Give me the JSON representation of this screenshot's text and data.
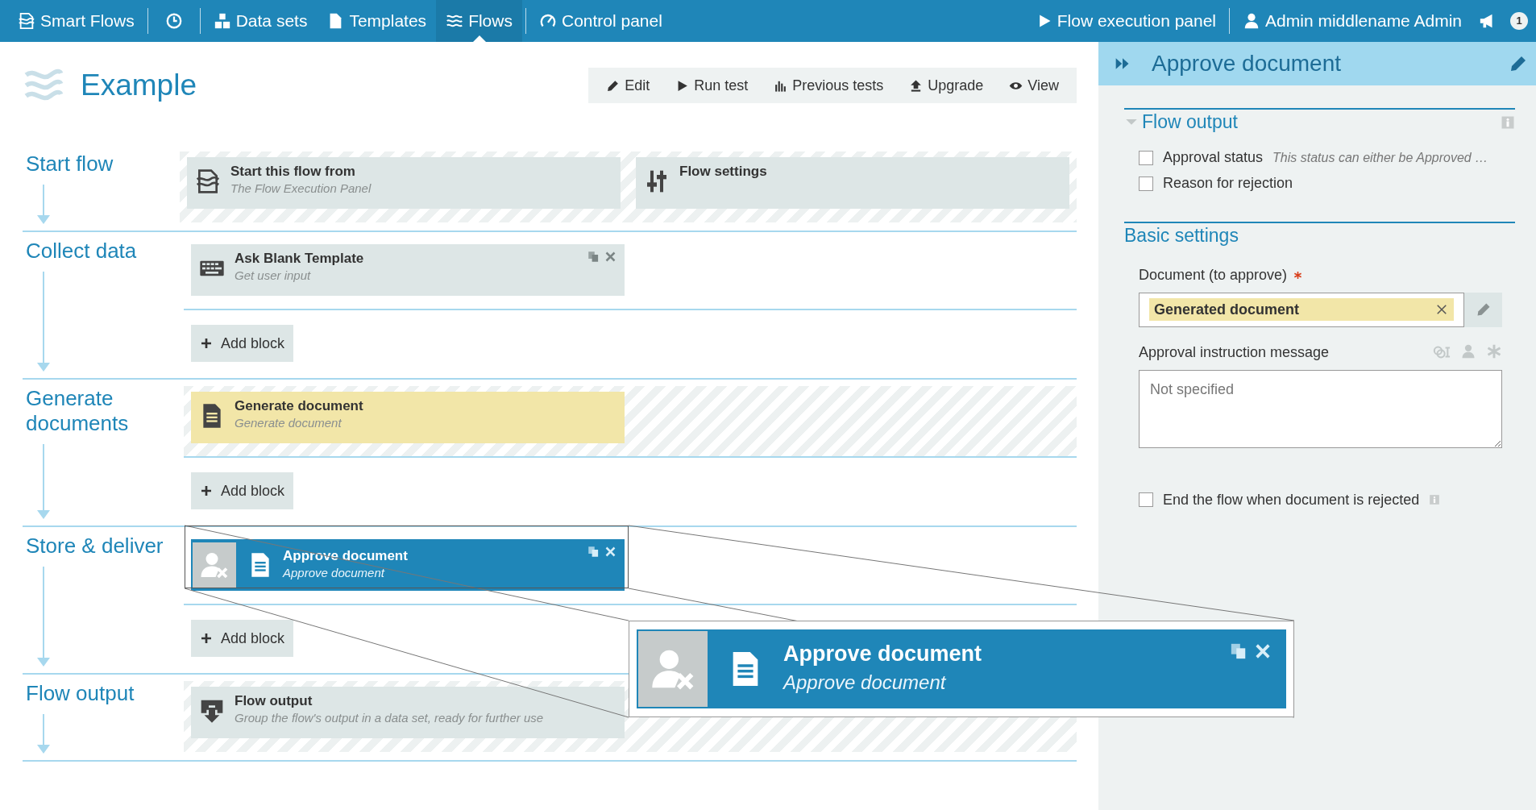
{
  "navbar": {
    "brand": "Smart Flows",
    "items": [
      {
        "label": "Data sets",
        "selected": false
      },
      {
        "label": "Templates",
        "selected": false
      },
      {
        "label": "Flows",
        "selected": true
      },
      {
        "label": "Control panel",
        "selected": false
      }
    ],
    "execution_panel": "Flow execution panel",
    "user": "Admin middlename Admin",
    "notifications": "1"
  },
  "page": {
    "title": "Example",
    "toolbar": [
      "Edit",
      "Run test",
      "Previous tests",
      "Upgrade",
      "View"
    ]
  },
  "sections": [
    {
      "title": "Start flow",
      "striped": true,
      "blocks": [
        {
          "kind": "start",
          "title": "Start this flow from",
          "subtitle": "The Flow Execution Panel",
          "selected": false,
          "actions": false
        },
        {
          "kind": "settings",
          "title": "Flow settings",
          "selected": false,
          "actions": false
        }
      ]
    },
    {
      "title": "Collect data",
      "striped": false,
      "blocks": [
        {
          "kind": "input",
          "title": "Ask Blank Template",
          "subtitle": "Get user input",
          "selected": false,
          "actions": true
        }
      ],
      "add_button": "Add block"
    },
    {
      "title": "Generate documents",
      "striped": true,
      "blocks": [
        {
          "kind": "document",
          "title": "Generate document",
          "subtitle": "Generate document",
          "selected": false,
          "actions": false
        }
      ],
      "add_button": "Add block"
    },
    {
      "title": "Store & deliver",
      "striped": false,
      "blocks": [
        {
          "kind": "approval",
          "title": "Approve document",
          "subtitle": "Approve document",
          "selected": true,
          "actions": true
        }
      ],
      "add_button": "Add block"
    },
    {
      "title": "Flow output",
      "striped": true,
      "blocks": [
        {
          "kind": "output",
          "title": "Flow output",
          "subtitle": "Group the flow's output in a data set, ready for further use",
          "selected": false,
          "actions": false
        }
      ]
    }
  ],
  "zoom_callout": {
    "title": "Approve document",
    "subtitle": "Approve document"
  },
  "panel": {
    "title": "Approve document",
    "output_section": {
      "title": "Flow output",
      "expanded": true,
      "items": [
        {
          "label": "Approval status",
          "hint": "This status can either be Approved …",
          "checked": false
        },
        {
          "label": "Reason for rejection",
          "checked": false
        }
      ]
    },
    "settings_section": {
      "title": "Basic settings",
      "document_label": "Document (to approve)",
      "required": true,
      "document_value": "Generated document",
      "message_label": "Approval instruction message",
      "message_placeholder": "Not specified",
      "end_flow": {
        "label": "End the flow when document is rejected",
        "checked": false
      }
    }
  }
}
